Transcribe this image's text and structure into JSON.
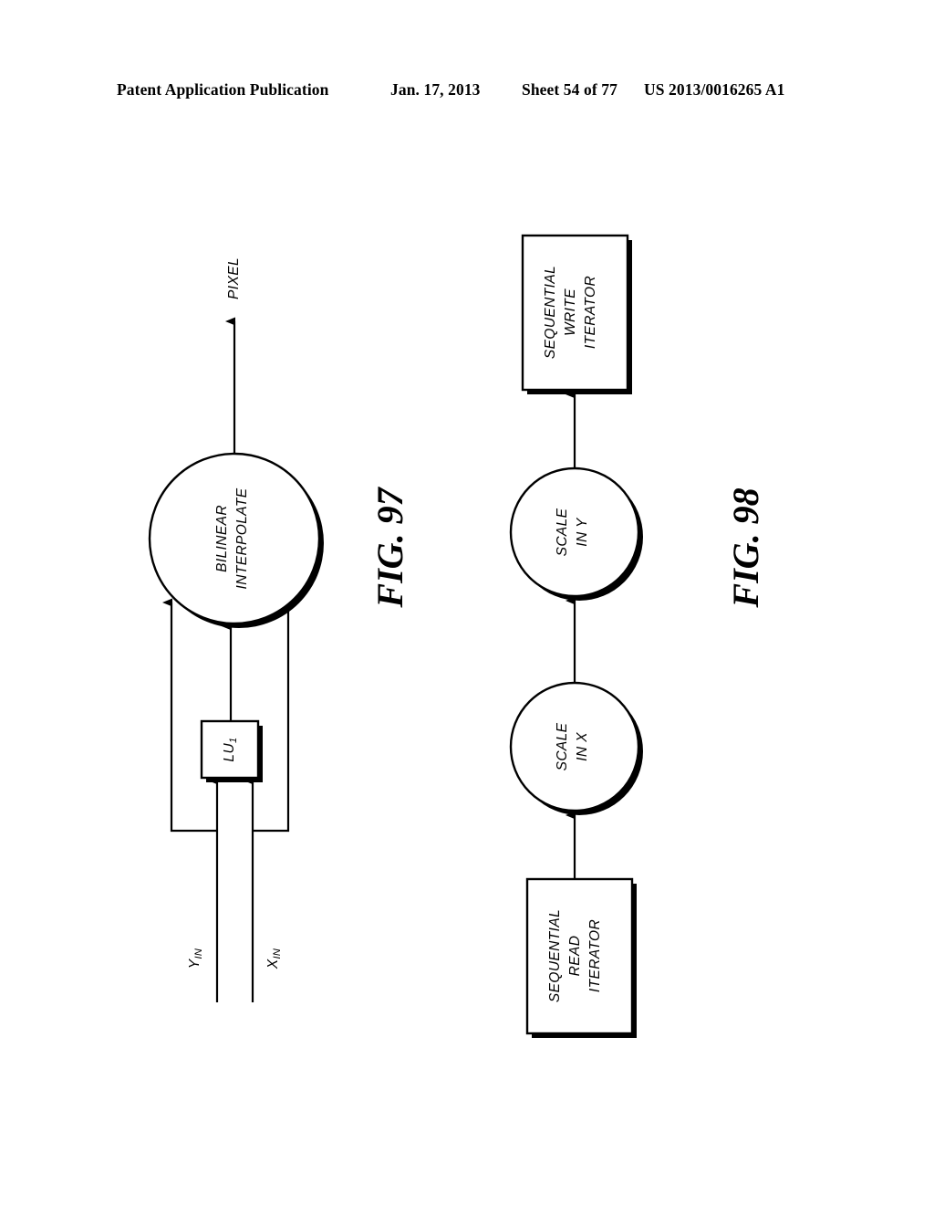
{
  "header": {
    "publication": "Patent Application Publication",
    "date": "Jan. 17, 2013",
    "sheet": "Sheet 54 of 77",
    "patent_number": "US 2013/0016265 A1"
  },
  "figures": [
    {
      "id": "fig-97",
      "label": "FIG. 97",
      "nodes": [
        {
          "id": "bilinear-interpolate",
          "shape": "circle",
          "lines": [
            "BILINEAR",
            "INTERPOLATE"
          ]
        },
        {
          "id": "lookup-unit-1",
          "shape": "box",
          "lines": [
            "LU"
          ],
          "subscript": "1"
        }
      ],
      "signals": [
        {
          "id": "y-in",
          "base": "Y",
          "subscript": "IN"
        },
        {
          "id": "x-in",
          "base": "X",
          "subscript": "IN"
        },
        {
          "id": "pixel-out",
          "base": "PIXEL",
          "subscript": ""
        }
      ]
    },
    {
      "id": "fig-98",
      "label": "FIG. 98",
      "nodes": [
        {
          "id": "sequential-write-iterator",
          "shape": "box",
          "lines": [
            "SEQUENTIAL",
            "WRITE",
            "ITERATOR"
          ]
        },
        {
          "id": "scale-in-y",
          "shape": "circle",
          "lines": [
            "SCALE",
            "IN Y"
          ]
        },
        {
          "id": "scale-in-x",
          "shape": "circle",
          "lines": [
            "SCALE",
            "IN X"
          ]
        },
        {
          "id": "sequential-read-iterator",
          "shape": "box",
          "lines": [
            "SEQUENTIAL",
            "READ",
            "ITERATOR"
          ]
        }
      ],
      "signals": []
    }
  ],
  "colors": {
    "ink": "#000000",
    "paper": "#ffffff"
  }
}
